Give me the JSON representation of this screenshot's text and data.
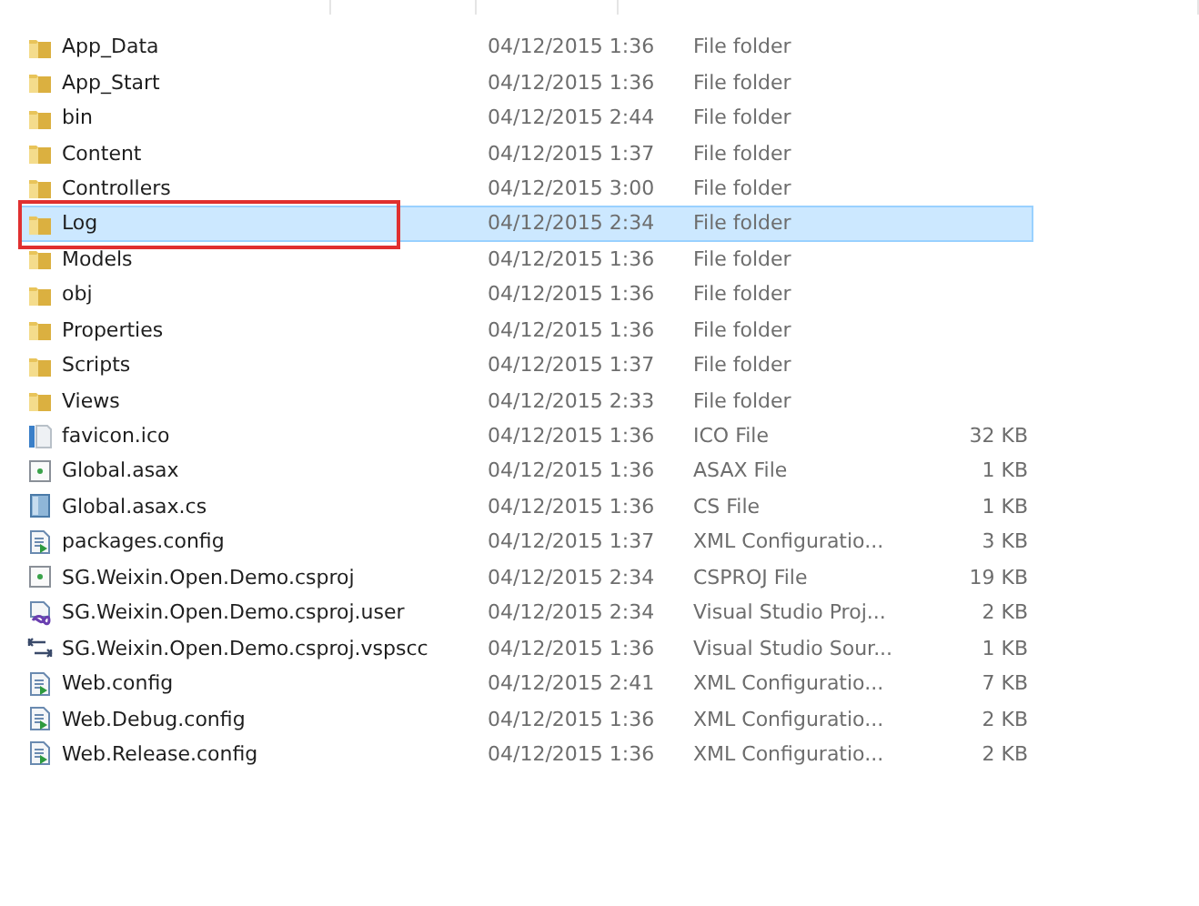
{
  "files": [
    {
      "name": "App_Data",
      "date": "04/12/2015 1:36",
      "type": "File folder",
      "kind": "folder",
      "selected": false,
      "annotated": false
    },
    {
      "name": "App_Start",
      "date": "04/12/2015 1:36",
      "type": "File folder",
      "kind": "folder",
      "selected": false,
      "annotated": false
    },
    {
      "name": "bin",
      "date": "04/12/2015 2:44",
      "type": "File folder",
      "kind": "folder",
      "selected": false,
      "annotated": false
    },
    {
      "name": "Content",
      "date": "04/12/2015 1:37",
      "type": "File folder",
      "kind": "folder",
      "selected": false,
      "annotated": false
    },
    {
      "name": "Controllers",
      "date": "04/12/2015 3:00",
      "type": "File folder",
      "kind": "folder",
      "selected": false,
      "annotated": false
    },
    {
      "name": "Log",
      "date": "04/12/2015 2:34",
      "type": "File folder",
      "kind": "folder",
      "selected": true,
      "annotated": true
    },
    {
      "name": "Models",
      "date": "04/12/2015 1:36",
      "type": "File folder",
      "kind": "folder",
      "selected": false,
      "annotated": false
    },
    {
      "name": "obj",
      "date": "04/12/2015 1:36",
      "type": "File folder",
      "kind": "folder",
      "selected": false,
      "annotated": false
    },
    {
      "name": "Properties",
      "date": "04/12/2015 1:36",
      "type": "File folder",
      "kind": "folder",
      "selected": false,
      "annotated": false
    },
    {
      "name": "Scripts",
      "date": "04/12/2015 1:37",
      "type": "File folder",
      "kind": "folder",
      "selected": false,
      "annotated": false
    },
    {
      "name": "Views",
      "date": "04/12/2015 2:33",
      "type": "File folder",
      "kind": "folder",
      "selected": false,
      "annotated": false
    },
    {
      "name": "favicon.ico",
      "date": "04/12/2015 1:36",
      "type": "ICO File",
      "size": "32 KB",
      "kind": "image",
      "selected": false,
      "annotated": false
    },
    {
      "name": "Global.asax",
      "date": "04/12/2015 1:36",
      "type": "ASAX File",
      "size": "1 KB",
      "kind": "web",
      "selected": false,
      "annotated": false
    },
    {
      "name": "Global.asax.cs",
      "date": "04/12/2015 1:36",
      "type": "CS File",
      "size": "1 KB",
      "kind": "code",
      "selected": false,
      "annotated": false
    },
    {
      "name": "packages.config",
      "date": "04/12/2015 1:37",
      "type": "XML Configuratio...",
      "size": "3 KB",
      "kind": "config",
      "selected": false,
      "annotated": false
    },
    {
      "name": "SG.Weixin.Open.Demo.csproj",
      "date": "04/12/2015 2:34",
      "type": "CSPROJ File",
      "size": "19 KB",
      "kind": "web",
      "selected": false,
      "annotated": false
    },
    {
      "name": "SG.Weixin.Open.Demo.csproj.user",
      "date": "04/12/2015 2:34",
      "type": "Visual Studio Proj...",
      "size": "2 KB",
      "kind": "vs",
      "selected": false,
      "annotated": false
    },
    {
      "name": "SG.Weixin.Open.Demo.csproj.vspscc",
      "date": "04/12/2015 1:36",
      "type": "Visual Studio Sour...",
      "size": "1 KB",
      "kind": "sync",
      "selected": false,
      "annotated": false
    },
    {
      "name": "Web.config",
      "date": "04/12/2015 2:41",
      "type": "XML Configuratio...",
      "size": "7 KB",
      "kind": "config",
      "selected": false,
      "annotated": false
    },
    {
      "name": "Web.Debug.config",
      "date": "04/12/2015 1:36",
      "type": "XML Configuratio...",
      "size": "2 KB",
      "kind": "config",
      "selected": false,
      "annotated": false
    },
    {
      "name": "Web.Release.config",
      "date": "04/12/2015 1:36",
      "type": "XML Configuratio...",
      "size": "2 KB",
      "kind": "config",
      "selected": false,
      "annotated": false
    }
  ]
}
